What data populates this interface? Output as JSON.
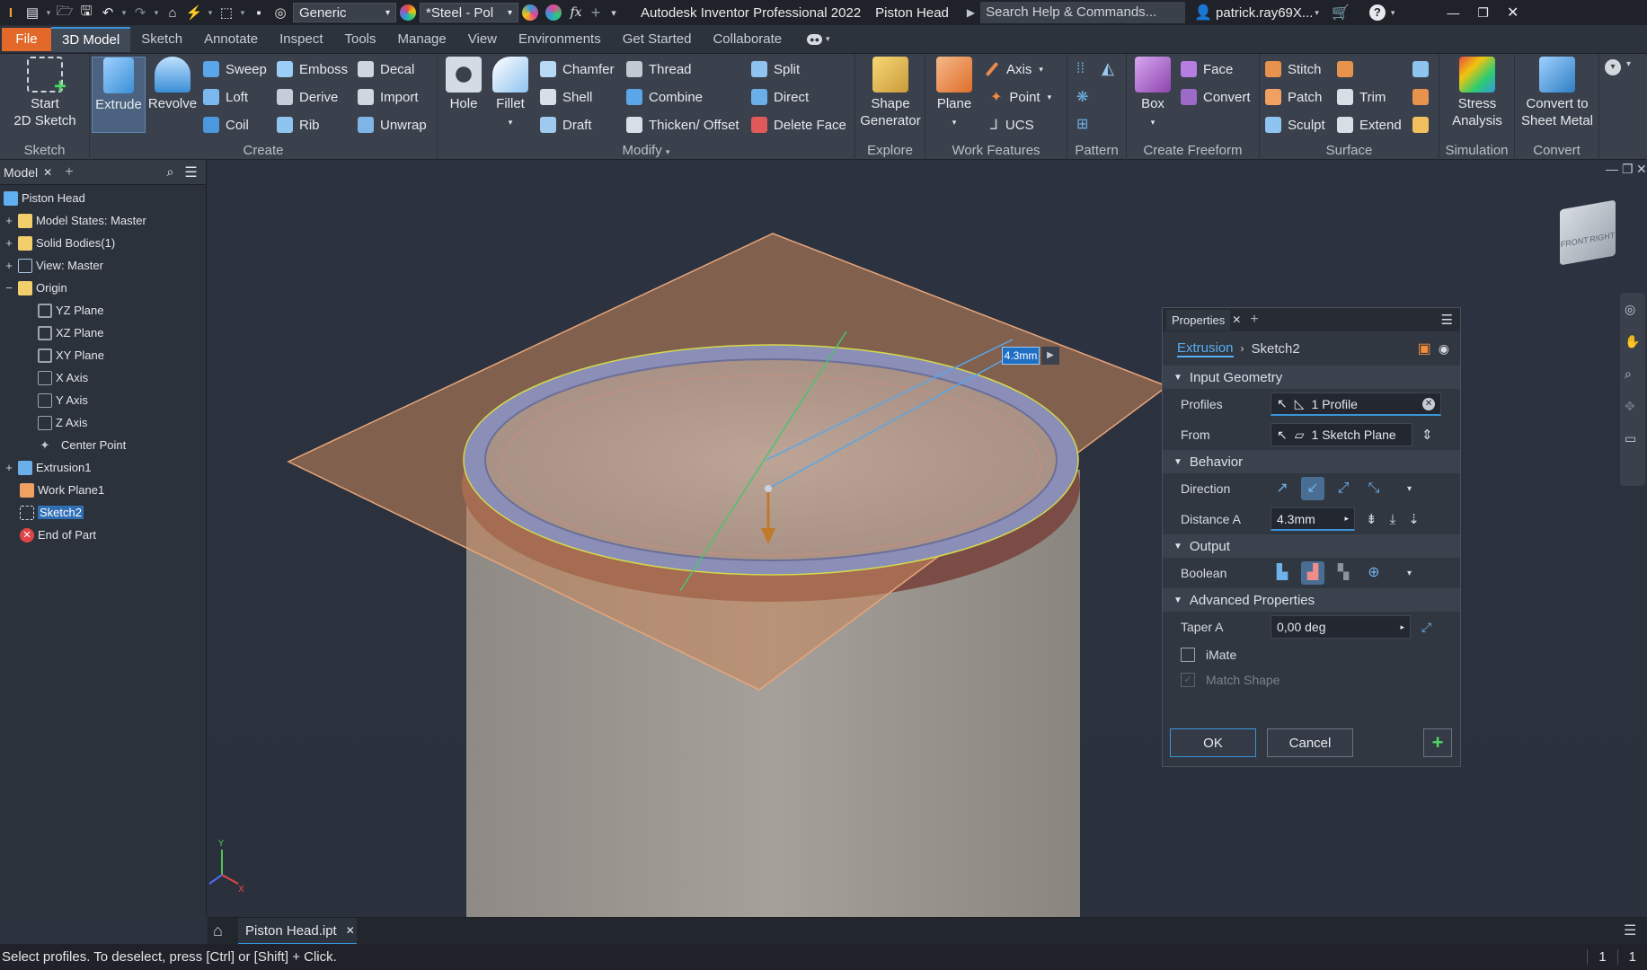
{
  "title_bar": {
    "appearance": "Generic",
    "material": "*Steel - Pol",
    "app_title": "Autodesk Inventor Professional 2022",
    "doc_title": "Piston Head",
    "search_placeholder": "Search Help & Commands...",
    "user": "patrick.ray69X..."
  },
  "tabs": [
    "File",
    "3D Model",
    "Sketch",
    "Annotate",
    "Inspect",
    "Tools",
    "Manage",
    "View",
    "Environments",
    "Get Started",
    "Collaborate"
  ],
  "ribbon": {
    "sketch": {
      "start_line1": "Start",
      "start_line2": "2D Sketch",
      "label": "Sketch"
    },
    "create": {
      "extrude": "Extrude",
      "revolve": "Revolve",
      "sweep": "Sweep",
      "loft": "Loft",
      "coil": "Coil",
      "emboss": "Emboss",
      "derive": "Derive",
      "rib": "Rib",
      "decal": "Decal",
      "import": "Import",
      "unwrap": "Unwrap",
      "label": "Create"
    },
    "modify": {
      "hole": "Hole",
      "fillet": "Fillet",
      "chamfer": "Chamfer",
      "shell": "Shell",
      "draft": "Draft",
      "thread": "Thread",
      "combine": "Combine",
      "thicken": "Thicken/ Offset",
      "split": "Split",
      "direct": "Direct",
      "delete_face": "Delete Face",
      "label": "Modify"
    },
    "explore": {
      "line1": "Shape",
      "line2": "Generator",
      "label": "Explore"
    },
    "work": {
      "plane": "Plane",
      "axis": "Axis",
      "point": "Point",
      "ucs": "UCS",
      "label": "Work Features"
    },
    "pattern": {
      "label": "Pattern"
    },
    "freeform": {
      "box": "Box",
      "face": "Face",
      "convert": "Convert",
      "label": "Create Freeform"
    },
    "surface": {
      "stitch": "Stitch",
      "patch": "Patch",
      "sculpt": "Sculpt",
      "trim": "Trim",
      "extend": "Extend",
      "label": "Surface"
    },
    "simulation": {
      "line1": "Stress",
      "line2": "Analysis",
      "label": "Simulation"
    },
    "convert": {
      "line1": "Convert to",
      "line2": "Sheet Metal",
      "label": "Convert"
    }
  },
  "browser": {
    "tab": "Model",
    "nodes": [
      "Piston Head",
      "Model States: Master",
      "Solid Bodies(1)",
      "View: Master",
      "Origin",
      "YZ Plane",
      "XZ Plane",
      "XY Plane",
      "X Axis",
      "Y Axis",
      "Z Axis",
      "Center Point",
      "Extrusion1",
      "Work Plane1",
      "Sketch2",
      "End of Part"
    ]
  },
  "viewport": {
    "dim_value": "4.3mm",
    "viewcube_front": "FRONT",
    "viewcube_right": "RIGHT"
  },
  "properties": {
    "title": "Properties",
    "crumb_feature": "Extrusion",
    "crumb_sketch": "Sketch2",
    "input_geometry": "Input Geometry",
    "profiles_label": "Profiles",
    "profiles_value": "1 Profile",
    "from_label": "From",
    "from_value": "1 Sketch Plane",
    "behavior": "Behavior",
    "direction_label": "Direction",
    "distance_label": "Distance A",
    "distance_value": "4.3mm",
    "output": "Output",
    "boolean_label": "Boolean",
    "advanced": "Advanced Properties",
    "taper_label": "Taper A",
    "taper_value": "0,00 deg",
    "imate": "iMate",
    "match_shape": "Match Shape",
    "ok": "OK",
    "cancel": "Cancel"
  },
  "doc_tab": "Piston Head.ipt",
  "status": {
    "message": "Select profiles. To deselect, press [Ctrl] or [Shift] + Click.",
    "count1": "1",
    "count2": "1"
  }
}
